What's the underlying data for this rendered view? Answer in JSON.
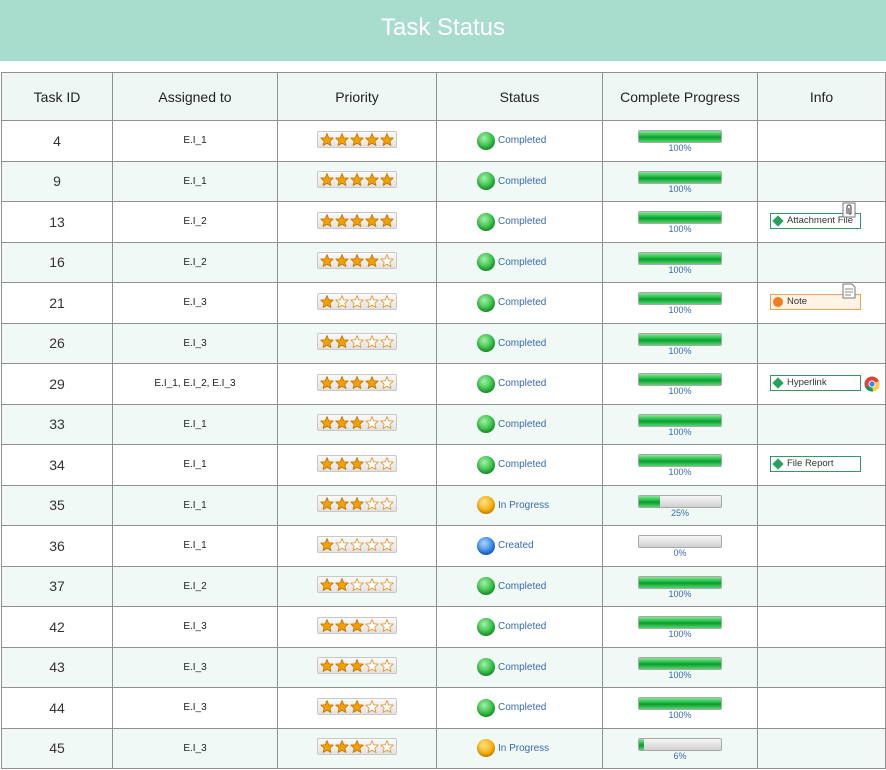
{
  "header": {
    "title": "Task Status"
  },
  "columns": [
    "Task ID",
    "Assigned to",
    "Priority",
    "Status",
    "Complete Progress",
    "Info"
  ],
  "colors": {
    "completed": "#2ab73a",
    "in_progress": "#f7a800",
    "created": "#2a7de1",
    "star_on": "#f5a000",
    "star_off": "#ffffff"
  },
  "rows": [
    {
      "id": "4",
      "assigned": "E.I_1",
      "stars": 5,
      "status": "Completed",
      "state": "completed",
      "progress": 100,
      "pct": "100%",
      "info": null
    },
    {
      "id": "9",
      "assigned": "E.I_1",
      "stars": 5,
      "status": "Completed",
      "state": "completed",
      "progress": 100,
      "pct": "100%",
      "info": null
    },
    {
      "id": "13",
      "assigned": "E.I_2",
      "stars": 5,
      "status": "Completed",
      "state": "completed",
      "progress": 100,
      "pct": "100%",
      "info": {
        "label": "Attachment File",
        "kind": "attachment",
        "icon": "paperclip-icon"
      }
    },
    {
      "id": "16",
      "assigned": "E.I_2",
      "stars": 4,
      "status": "Completed",
      "state": "completed",
      "progress": 100,
      "pct": "100%",
      "info": null
    },
    {
      "id": "21",
      "assigned": "E.I_3",
      "stars": 1,
      "status": "Completed",
      "state": "completed",
      "progress": 100,
      "pct": "100%",
      "info": {
        "label": "Note",
        "kind": "note",
        "icon": "note-icon"
      }
    },
    {
      "id": "26",
      "assigned": "E.I_3",
      "stars": 2,
      "status": "Completed",
      "state": "completed",
      "progress": 100,
      "pct": "100%",
      "info": null
    },
    {
      "id": "29",
      "assigned": "E.I_1, E.I_2, E.I_3",
      "stars": 4,
      "status": "Completed",
      "state": "completed",
      "progress": 100,
      "pct": "100%",
      "info": {
        "label": "Hyperlink",
        "kind": "hyperlink",
        "icon": "chrome-icon"
      }
    },
    {
      "id": "33",
      "assigned": "E.I_1",
      "stars": 3,
      "status": "Completed",
      "state": "completed",
      "progress": 100,
      "pct": "100%",
      "info": null
    },
    {
      "id": "34",
      "assigned": "E.I_1",
      "stars": 3,
      "status": "Completed",
      "state": "completed",
      "progress": 100,
      "pct": "100%",
      "info": {
        "label": "File Report",
        "kind": "report",
        "icon": null
      }
    },
    {
      "id": "35",
      "assigned": "E.I_1",
      "stars": 3,
      "status": "In Progress",
      "state": "in_progress",
      "progress": 25,
      "pct": "25%",
      "info": null
    },
    {
      "id": "36",
      "assigned": "E.I_1",
      "stars": 1,
      "status": "Created",
      "state": "created",
      "progress": 0,
      "pct": "0%",
      "info": null
    },
    {
      "id": "37",
      "assigned": "E.I_2",
      "stars": 2,
      "status": "Completed",
      "state": "completed",
      "progress": 100,
      "pct": "100%",
      "info": null
    },
    {
      "id": "42",
      "assigned": "E.I_3",
      "stars": 3,
      "status": "Completed",
      "state": "completed",
      "progress": 100,
      "pct": "100%",
      "info": null
    },
    {
      "id": "43",
      "assigned": "E.I_3",
      "stars": 3,
      "status": "Completed",
      "state": "completed",
      "progress": 100,
      "pct": "100%",
      "info": null
    },
    {
      "id": "44",
      "assigned": "E.I_3",
      "stars": 3,
      "status": "Completed",
      "state": "completed",
      "progress": 100,
      "pct": "100%",
      "info": null
    },
    {
      "id": "45",
      "assigned": "E.I_3",
      "stars": 3,
      "status": "In Progress",
      "state": "in_progress",
      "progress": 6,
      "pct": "6%",
      "info": null
    }
  ]
}
